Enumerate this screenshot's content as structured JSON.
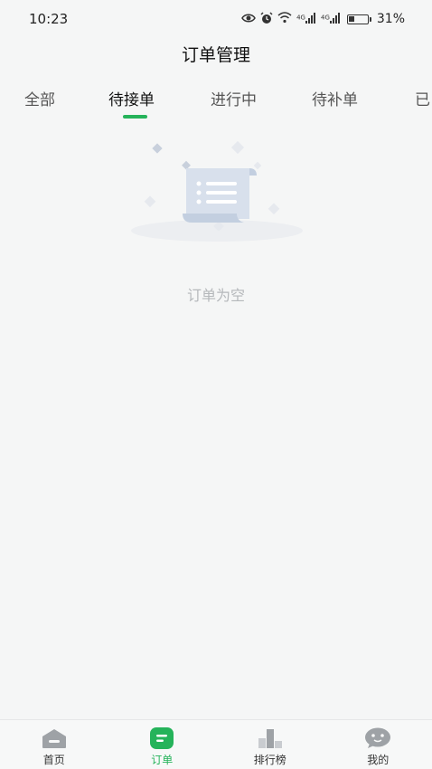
{
  "status_bar": {
    "time": "10:23",
    "net_label_1": "4G",
    "net_label_2": "4G",
    "battery_percent": "31%",
    "battery_level": 0.31
  },
  "header": {
    "title": "订单管理"
  },
  "tabs": [
    {
      "label": "全部"
    },
    {
      "label": "待接单"
    },
    {
      "label": "进行中"
    },
    {
      "label": "待补单"
    },
    {
      "label": "已"
    }
  ],
  "active_tab_index": 1,
  "empty_state": {
    "message": "订单为空"
  },
  "bottom_nav": [
    {
      "label": "首页",
      "icon": "home-icon"
    },
    {
      "label": "订单",
      "icon": "order-icon"
    },
    {
      "label": "排行榜",
      "icon": "ranking-icon"
    },
    {
      "label": "我的",
      "icon": "profile-icon"
    }
  ],
  "colors": {
    "accent": "#25b35a",
    "background": "#f5f6f6"
  }
}
